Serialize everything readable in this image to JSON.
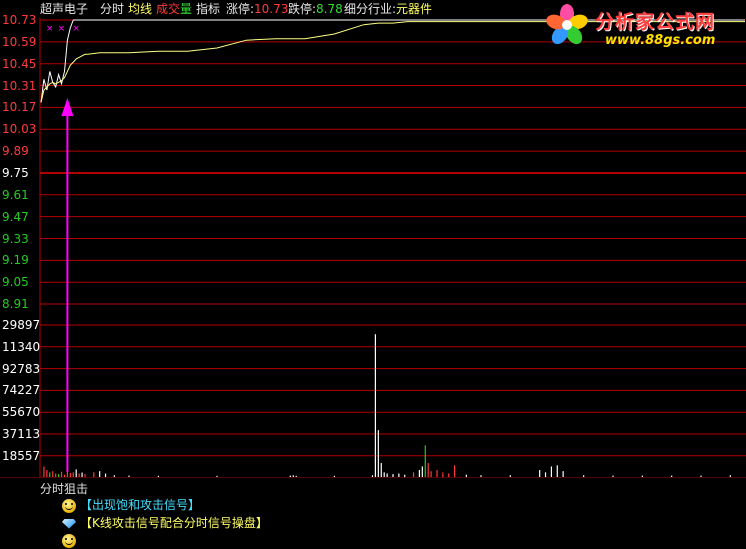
{
  "header": {
    "stock_name": "超声电子",
    "tab_timeshare": "分时",
    "tab_avg": "均线",
    "vol_part1": "成交",
    "vol_part2": "量",
    "tab_indicator": "指标",
    "limit_up_label": "涨停:",
    "limit_up_value": "10.73",
    "limit_down_label": "跌停:",
    "limit_down_value": "8.78",
    "industry_label": "细分行业:",
    "industry_value": "元器件"
  },
  "logo": {
    "name": "分析家公式网",
    "url": "www.88gs.com"
  },
  "price_axis": [
    "10.73",
    "10.59",
    "10.45",
    "10.31",
    "10.17",
    "10.03",
    "9.89",
    "9.75",
    "9.61",
    "9.47",
    "9.33",
    "9.19",
    "9.05",
    "8.91"
  ],
  "volume_axis": [
    "29897",
    "11340",
    "92783",
    "74227",
    "55670",
    "37113",
    "18557"
  ],
  "colors": {
    "up": "#ff3b3b",
    "down": "#22cc22",
    "neutral": "#ffffff",
    "grid": "#b30000",
    "price_line": "#ffffff",
    "avg_line": "#ffff80",
    "signal_arrow": "#ff00ff",
    "signal_text": "#44ddff",
    "signal_text_2": "#ffff66"
  },
  "bottom": {
    "title": "分时狙击",
    "signal1": "【出现饱和攻击信号】",
    "signal2": "【K线攻击信号配合分时信号操盘】"
  },
  "chart_data": {
    "type": "line",
    "title": "",
    "xlabel": "",
    "ylabel": "",
    "ylim": [
      8.78,
      10.73
    ],
    "reference_price": 9.75,
    "x": [
      0,
      1,
      2,
      3,
      4,
      5,
      6,
      7,
      8,
      9,
      10,
      11,
      12,
      13,
      14,
      15,
      16,
      20,
      25,
      30,
      40,
      50,
      60,
      70,
      80,
      90,
      100,
      110,
      115,
      120,
      125,
      130,
      140,
      160,
      180,
      200,
      210,
      230,
      240
    ],
    "series": [
      {
        "name": "price",
        "values": [
          10.2,
          10.35,
          10.28,
          10.4,
          10.33,
          10.3,
          10.38,
          10.32,
          10.4,
          10.6,
          10.68,
          10.73,
          10.73,
          10.73,
          10.73,
          10.73,
          10.73,
          10.73,
          10.73,
          10.73,
          10.73,
          10.73,
          10.73,
          10.73,
          10.73,
          10.73,
          10.73,
          10.73,
          10.73,
          10.73,
          10.73,
          10.73,
          10.73,
          10.73,
          10.73,
          10.73,
          10.73,
          10.73,
          10.73
        ]
      },
      {
        "name": "avg",
        "values": [
          10.2,
          10.28,
          10.3,
          10.32,
          10.33,
          10.32,
          10.33,
          10.34,
          10.36,
          10.4,
          10.44,
          10.46,
          10.48,
          10.49,
          10.5,
          10.51,
          10.51,
          10.52,
          10.52,
          10.52,
          10.53,
          10.53,
          10.55,
          10.6,
          10.61,
          10.61,
          10.64,
          10.7,
          10.71,
          10.71,
          10.72,
          10.72,
          10.72,
          10.72,
          10.72,
          10.72,
          10.72,
          10.72,
          10.72
        ]
      }
    ],
    "signal_x": 9,
    "signal_markers_x": [
      1,
      5,
      10
    ],
    "volume": {
      "ylim": [
        0,
        129897
      ],
      "bars": [
        {
          "x": 1,
          "v": 9000,
          "c": "up"
        },
        {
          "x": 2,
          "v": 6000,
          "c": "up"
        },
        {
          "x": 3,
          "v": 4000,
          "c": "down"
        },
        {
          "x": 4,
          "v": 5000,
          "c": "up"
        },
        {
          "x": 5,
          "v": 3000,
          "c": "up"
        },
        {
          "x": 6,
          "v": 2500,
          "c": "down"
        },
        {
          "x": 7,
          "v": 4500,
          "c": "up"
        },
        {
          "x": 8,
          "v": 2000,
          "c": "up"
        },
        {
          "x": 9,
          "v": 6000,
          "c": "up"
        },
        {
          "x": 10,
          "v": 3500,
          "c": "up"
        },
        {
          "x": 11,
          "v": 4000,
          "c": "up"
        },
        {
          "x": 12,
          "v": 6500,
          "c": "neutral"
        },
        {
          "x": 13,
          "v": 3000,
          "c": "up"
        },
        {
          "x": 14,
          "v": 3800,
          "c": "neutral"
        },
        {
          "x": 15,
          "v": 2500,
          "c": "up"
        },
        {
          "x": 18,
          "v": 4000,
          "c": "up"
        },
        {
          "x": 20,
          "v": 5000,
          "c": "neutral"
        },
        {
          "x": 22,
          "v": 3000,
          "c": "neutral"
        },
        {
          "x": 25,
          "v": 1500,
          "c": "neutral"
        },
        {
          "x": 30,
          "v": 1200,
          "c": "neutral"
        },
        {
          "x": 40,
          "v": 1000,
          "c": "neutral"
        },
        {
          "x": 60,
          "v": 1000,
          "c": "neutral"
        },
        {
          "x": 85,
          "v": 1200,
          "c": "neutral"
        },
        {
          "x": 86,
          "v": 1500,
          "c": "neutral"
        },
        {
          "x": 87,
          "v": 1000,
          "c": "neutral"
        },
        {
          "x": 100,
          "v": 1000,
          "c": "neutral"
        },
        {
          "x": 113,
          "v": 1500,
          "c": "neutral"
        },
        {
          "x": 114,
          "v": 122000,
          "c": "neutral"
        },
        {
          "x": 115,
          "v": 40000,
          "c": "neutral"
        },
        {
          "x": 116,
          "v": 12000,
          "c": "neutral"
        },
        {
          "x": 117,
          "v": 4000,
          "c": "neutral"
        },
        {
          "x": 118,
          "v": 3000,
          "c": "neutral"
        },
        {
          "x": 120,
          "v": 2500,
          "c": "neutral"
        },
        {
          "x": 122,
          "v": 3000,
          "c": "neutral"
        },
        {
          "x": 124,
          "v": 2000,
          "c": "neutral"
        },
        {
          "x": 127,
          "v": 4000,
          "c": "up"
        },
        {
          "x": 129,
          "v": 6000,
          "c": "neutral"
        },
        {
          "x": 130,
          "v": 9000,
          "c": "neutral"
        },
        {
          "x": 131,
          "v": 27000,
          "c": "down"
        },
        {
          "x": 132,
          "v": 12000,
          "c": "up"
        },
        {
          "x": 133,
          "v": 5000,
          "c": "up"
        },
        {
          "x": 135,
          "v": 6000,
          "c": "up"
        },
        {
          "x": 137,
          "v": 4000,
          "c": "up"
        },
        {
          "x": 139,
          "v": 3000,
          "c": "up"
        },
        {
          "x": 141,
          "v": 10000,
          "c": "up"
        },
        {
          "x": 145,
          "v": 2000,
          "c": "neutral"
        },
        {
          "x": 150,
          "v": 1500,
          "c": "neutral"
        },
        {
          "x": 160,
          "v": 1500,
          "c": "neutral"
        },
        {
          "x": 170,
          "v": 6000,
          "c": "neutral"
        },
        {
          "x": 172,
          "v": 4000,
          "c": "neutral"
        },
        {
          "x": 174,
          "v": 9000,
          "c": "neutral"
        },
        {
          "x": 176,
          "v": 10000,
          "c": "neutral"
        },
        {
          "x": 178,
          "v": 5000,
          "c": "neutral"
        },
        {
          "x": 185,
          "v": 1500,
          "c": "neutral"
        },
        {
          "x": 195,
          "v": 1200,
          "c": "neutral"
        },
        {
          "x": 205,
          "v": 1200,
          "c": "neutral"
        },
        {
          "x": 215,
          "v": 1200,
          "c": "neutral"
        },
        {
          "x": 225,
          "v": 1200,
          "c": "neutral"
        },
        {
          "x": 235,
          "v": 1500,
          "c": "neutral"
        }
      ]
    }
  }
}
